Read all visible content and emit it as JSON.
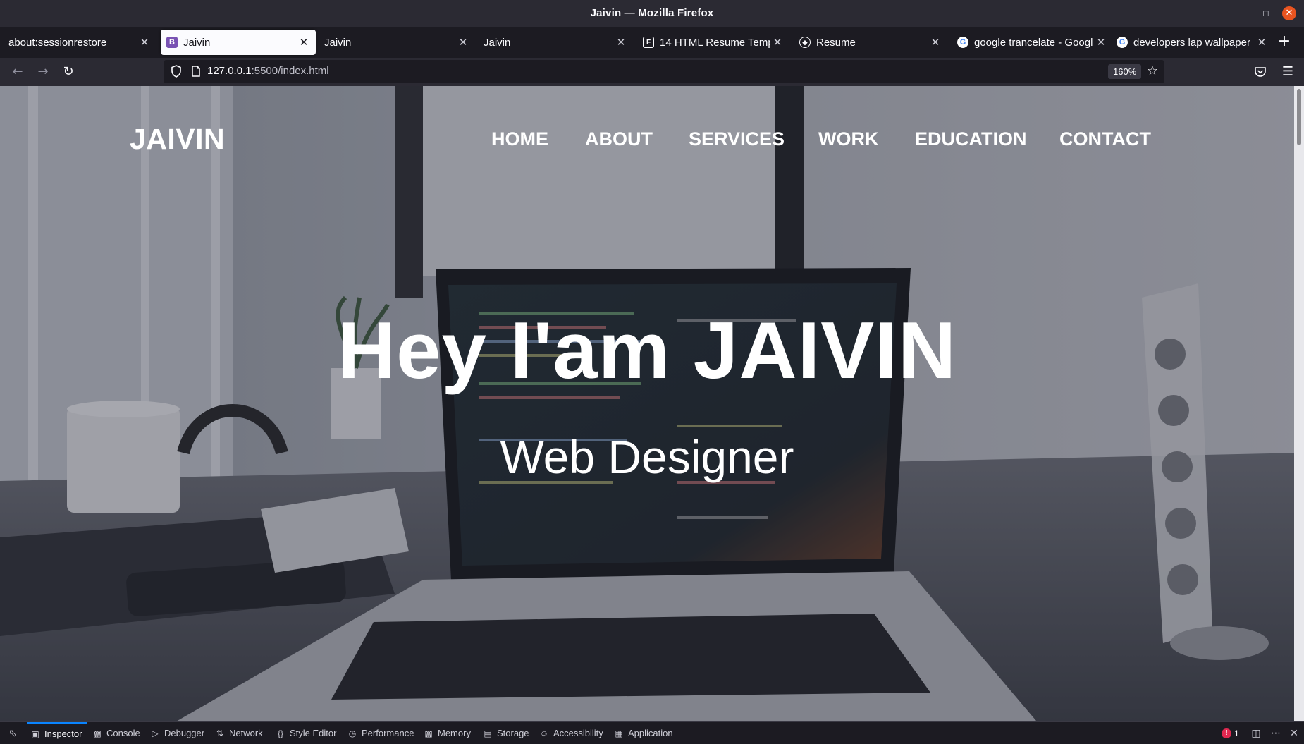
{
  "window": {
    "title": "Jaivin — Mozilla Firefox",
    "minimize_icon": "minimize-icon",
    "maximize_icon": "maximize-icon",
    "close_icon": "close-icon"
  },
  "tabs": [
    {
      "label": "about:sessionrestore",
      "favicon": "none",
      "active": false
    },
    {
      "label": "Jaivin",
      "favicon": "bootstrap-icon",
      "active": true
    },
    {
      "label": "Jaivin",
      "favicon": "none",
      "active": false
    },
    {
      "label": "Jaivin",
      "favicon": "none",
      "active": false
    },
    {
      "label": "14 HTML Resume Templa",
      "favicon": "f-icon",
      "active": false
    },
    {
      "label": "Resume",
      "favicon": "resume-icon",
      "active": false
    },
    {
      "label": "google trancelate - Googl",
      "favicon": "google-icon",
      "active": false
    },
    {
      "label": "developers lap wallpaper",
      "favicon": "google-icon",
      "active": false
    }
  ],
  "new_tab_label": "+",
  "navbar": {
    "url_host": "127.0.0.1",
    "url_rest": ":5500/index.html",
    "zoom": "160%"
  },
  "site": {
    "logo": "JAIVIN",
    "nav": [
      "HOME",
      "ABOUT",
      "SERVICES",
      "WORK",
      "EDUCATION",
      "CONTACT"
    ],
    "hero_title": "Hey I'am JAIVIN",
    "hero_subtitle": "Web Designer"
  },
  "devtools": {
    "tabs": [
      "Inspector",
      "Console",
      "Debugger",
      "Network",
      "Style Editor",
      "Performance",
      "Memory",
      "Storage",
      "Accessibility",
      "Application"
    ],
    "active_tab": "Inspector",
    "error_count": "1"
  },
  "colors": {
    "chrome_dark": "#2b2a33",
    "tabbar_bg": "#1c1b22",
    "active_tab_bg": "#fbfbfe",
    "accent_blue": "#0a84ff",
    "close_orange": "#e95420",
    "error_red": "#e22850"
  }
}
